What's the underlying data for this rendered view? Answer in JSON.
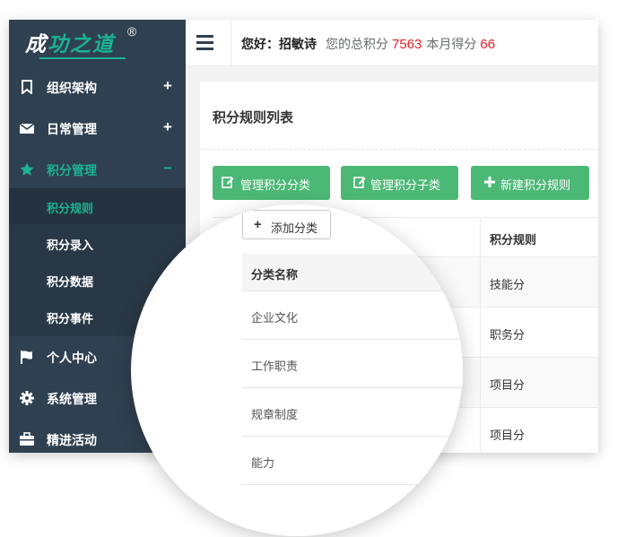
{
  "app": {
    "logo": {
      "text_white": "成",
      "text_green": "功之道",
      "reg": "®"
    }
  },
  "sidebar": {
    "items": [
      {
        "label": "组织架构",
        "icon": "bookmark-icon",
        "toggle": "+"
      },
      {
        "label": "日常管理",
        "icon": "envelope-icon",
        "toggle": "+"
      },
      {
        "label": "积分管理",
        "icon": "star-icon",
        "toggle": "−",
        "active": true
      },
      {
        "label": "个人中心",
        "icon": "flag-icon"
      },
      {
        "label": "系统管理",
        "icon": "gear-icon"
      },
      {
        "label": "精进活动",
        "icon": "briefcase-icon"
      }
    ],
    "submenu": [
      {
        "label": "积分规则",
        "current": true
      },
      {
        "label": "积分录入"
      },
      {
        "label": "积分数据"
      },
      {
        "label": "积分事件"
      }
    ]
  },
  "topbar": {
    "greeting": "您好：招敏诗",
    "total_label": "您的总积分",
    "total_value": "7563",
    "month_label": "本月得分",
    "month_value": "66"
  },
  "panel": {
    "title": "积分规则列表",
    "buttons": [
      {
        "label": "管理积分分类",
        "icon": "edit-icon"
      },
      {
        "label": "管理积分子类",
        "icon": "edit-icon"
      },
      {
        "label": "新建积分规则",
        "icon": "plus-icon"
      }
    ],
    "table": {
      "column_header": "积分规则",
      "rows": [
        "技能分",
        "职务分",
        "项目分",
        "项目分"
      ]
    }
  },
  "popup": {
    "add_button": "添加分类",
    "column_header": "分类名称",
    "rows": [
      "企业文化",
      "工作职责",
      "规章制度",
      "能力"
    ]
  },
  "colors": {
    "sidebar_bg": "#2f4050",
    "accent": "#1ab394",
    "button_green": "#4cb876",
    "highlight_red": "#ed1c24"
  }
}
